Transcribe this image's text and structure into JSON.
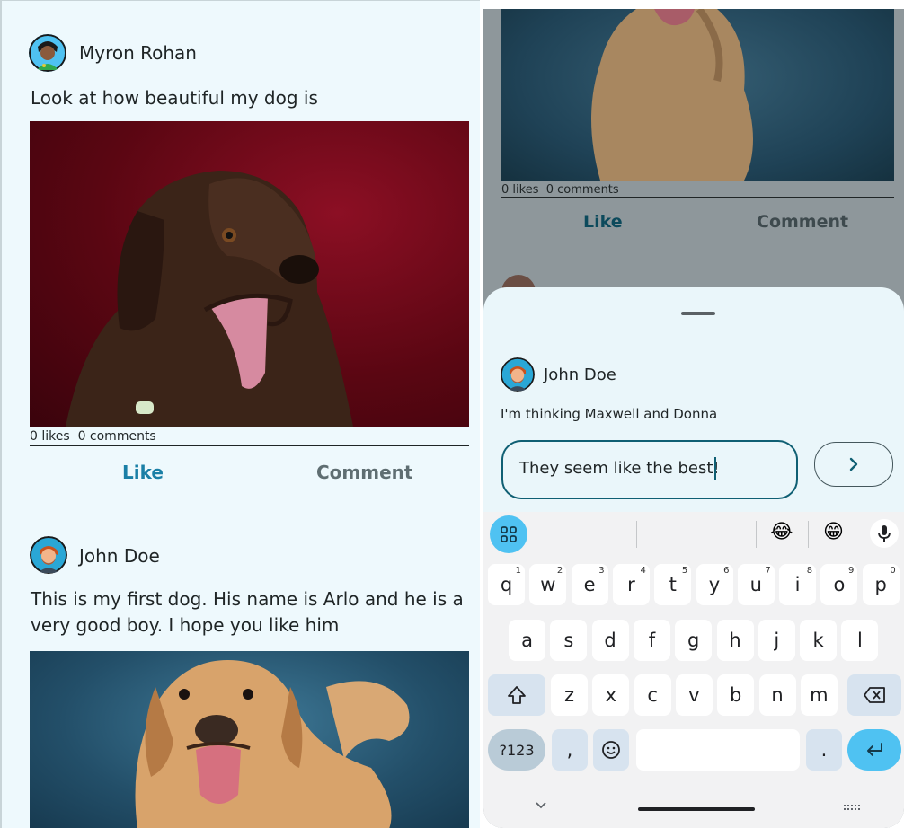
{
  "feed": {
    "post1": {
      "author": "Myron Rohan",
      "caption": "Look at how beautiful my dog is",
      "likes": "0 likes",
      "comments": "0 comments",
      "like_label": "Like",
      "comment_label": "Comment"
    },
    "post2": {
      "author": "John  Doe",
      "caption_line1": "This is my first dog. His name is Arlo and he is a",
      "caption_line2": "very good boy. I hope you like him"
    }
  },
  "overlay_feed": {
    "likes": "0 likes",
    "comments": "0 comments",
    "like_label": "Like",
    "comment_label": "Comment"
  },
  "comment_sheet": {
    "author": "John  Doe",
    "comment": "I'm thinking Maxwell and Donna",
    "input_value": "They seem like the best!",
    "send_icon": "chevron-right-icon"
  },
  "keyboard": {
    "row1": [
      {
        "k": "q",
        "n": "1"
      },
      {
        "k": "w",
        "n": "2"
      },
      {
        "k": "e",
        "n": "3"
      },
      {
        "k": "r",
        "n": "4"
      },
      {
        "k": "t",
        "n": "5"
      },
      {
        "k": "y",
        "n": "6"
      },
      {
        "k": "u",
        "n": "7"
      },
      {
        "k": "i",
        "n": "8"
      },
      {
        "k": "o",
        "n": "9"
      },
      {
        "k": "p",
        "n": "0"
      }
    ],
    "row2": [
      "a",
      "s",
      "d",
      "f",
      "g",
      "h",
      "j",
      "k",
      "l"
    ],
    "row3": [
      "z",
      "x",
      "c",
      "v",
      "b",
      "n",
      "m"
    ],
    "symbols_label": "?123",
    "comma": ",",
    "period": ".",
    "suggestions": [
      "😂",
      "😁"
    ],
    "icons": {
      "apps": "apps-grid-icon",
      "mic": "microphone-icon",
      "shift": "shift-icon",
      "backspace": "backspace-icon",
      "emoji": "emoji-icon",
      "enter": "enter-icon",
      "collapse": "chevron-down-icon",
      "keyboard_switch": "keyboard-icon"
    }
  },
  "colors": {
    "accent": "#0f5f73",
    "comment_text": "#55686d",
    "panel_bg": "#eef9fd",
    "key_accent": "#4fc2f2"
  }
}
